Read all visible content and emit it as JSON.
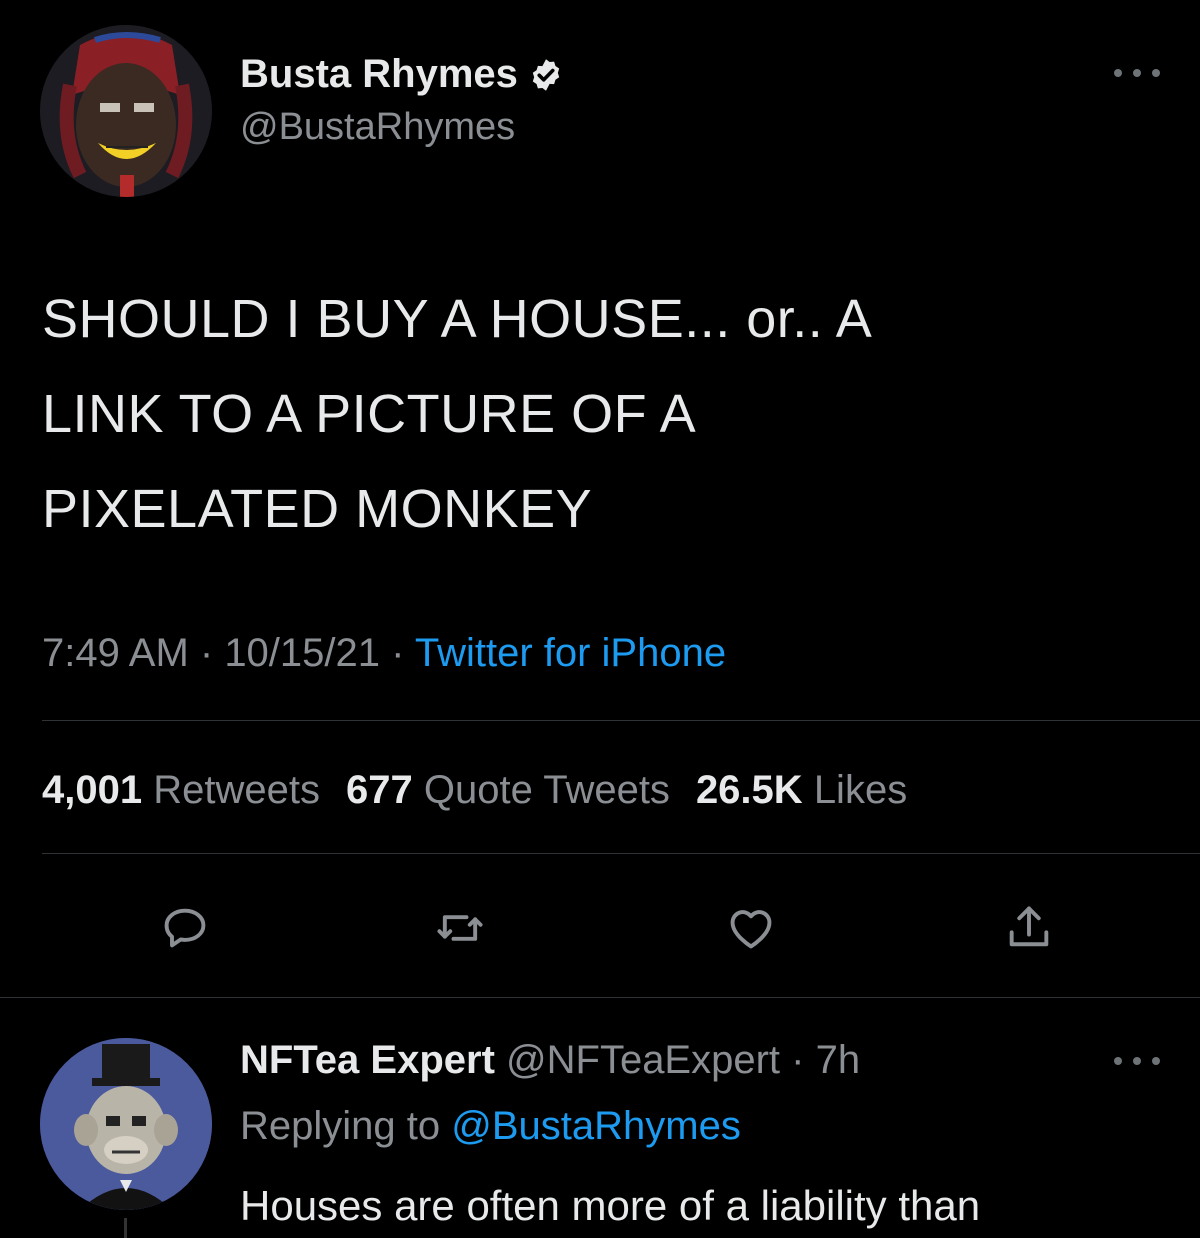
{
  "tweet": {
    "display_name": "Busta Rhymes",
    "handle": "@BustaRhymes",
    "text": "SHOULD I BUY A HOUSE... or.. A\nLINK TO A PICTURE OF A\nPIXELATED MONKEY",
    "time": "7:49 AM",
    "date": "10/15/21",
    "separator": " · ",
    "source": "Twitter for iPhone",
    "stats": {
      "retweets_count": "4,001",
      "retweets_label": "Retweets",
      "quotes_count": "677",
      "quotes_label": "Quote Tweets",
      "likes_count": "26.5K",
      "likes_label": "Likes"
    },
    "icons": {
      "reply": "reply-icon",
      "retweet": "retweet-icon",
      "like": "heart-icon",
      "share": "share-icon",
      "more": "more-icon",
      "verified": "verified-badge-icon"
    }
  },
  "reply": {
    "display_name": "NFTea Expert",
    "handle": "@NFTeaExpert",
    "separator": " · ",
    "age": "7h",
    "replying_prefix": "Replying to ",
    "replying_to": "@BustaRhymes",
    "text": "Houses are often more of a liability than"
  },
  "colors": {
    "background": "#000000",
    "text": "#e7e9ea",
    "secondary": "#8b8f94",
    "link": "#1d9bf0",
    "divider": "#2f3336"
  }
}
